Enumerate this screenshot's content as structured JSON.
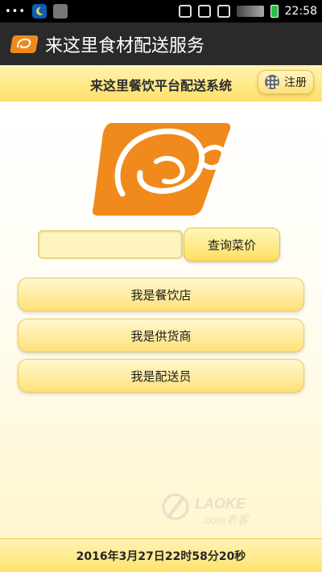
{
  "status_bar": {
    "dots": "•••",
    "time": "22:58"
  },
  "app_bar": {
    "title": "来这里食材配送服务",
    "icon": "app-logo-icon"
  },
  "header": {
    "title": "来这里餐饮平台配送系统",
    "register_label": "注册",
    "register_icon": "grid-icon"
  },
  "search": {
    "value": "",
    "query_button_label": "查询菜价"
  },
  "roles": [
    {
      "label": "我是餐饮店"
    },
    {
      "label": "我是供货商"
    },
    {
      "label": "我是配送员"
    }
  ],
  "watermark": {
    "text_main": "LAOKE",
    "text_sub": ".com老客"
  },
  "footer": {
    "datetime": "2016年3月27日22时58分20秒"
  },
  "colors": {
    "accent_orange": "#f0891b",
    "gold": "#ffe16a",
    "status_bar": "#000000",
    "app_bar": "#2a2a2a"
  }
}
